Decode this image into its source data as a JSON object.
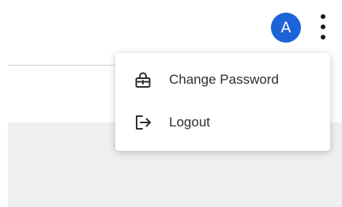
{
  "header": {
    "avatar_initial": "A",
    "avatar_color": "#1c63d8",
    "more_icon": "kebab-vertical-icon"
  },
  "user_menu": {
    "items": [
      {
        "label": "Change Password",
        "icon": "lock-icon"
      },
      {
        "label": "Logout",
        "icon": "logout-icon"
      }
    ]
  }
}
